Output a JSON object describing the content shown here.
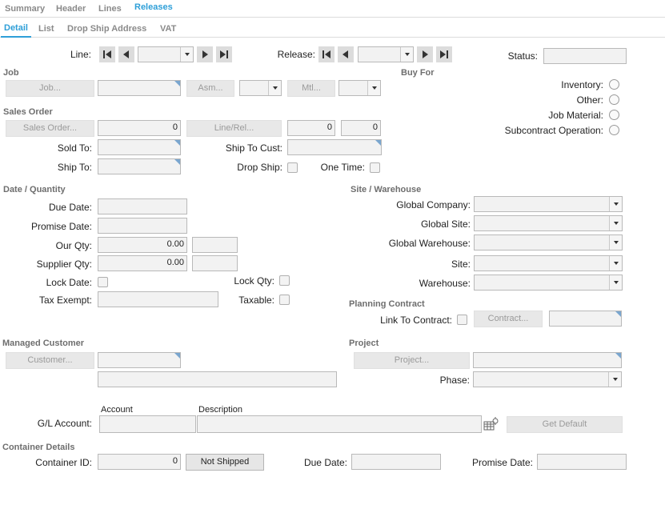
{
  "tabs_top": [
    "Summary",
    "Header",
    "Lines",
    "Releases"
  ],
  "tabs_sub": [
    "Detail",
    "List",
    "Drop Ship Address",
    "VAT"
  ],
  "line_label": "Line:",
  "release_label": "Release:",
  "status_label": "Status:",
  "job": {
    "section": "Job",
    "job_btn": "Job...",
    "asm_btn": "Asm...",
    "mtl_btn": "Mtl..."
  },
  "buy_for": {
    "section": "Buy For",
    "inventory": "Inventory:",
    "other": "Other:",
    "job_material": "Job Material:",
    "subcontract": "Subcontract Operation:"
  },
  "sales_order": {
    "section": "Sales Order",
    "so_btn": "Sales Order...",
    "so_value": "0",
    "linerel_btn": "Line/Rel...",
    "line_value": "0",
    "rel_value": "0",
    "sold_to": "Sold To:",
    "ship_to_cust": "Ship To Cust:",
    "ship_to": "Ship To:",
    "drop_ship": "Drop Ship:",
    "one_time": "One Time:"
  },
  "date_qty": {
    "section": "Date / Quantity",
    "due_date": "Due Date:",
    "promise_date": "Promise Date:",
    "our_qty": "Our Qty:",
    "our_qty_value": "0.00",
    "supplier_qty": "Supplier Qty:",
    "supplier_qty_value": "0.00",
    "lock_date": "Lock Date:",
    "lock_qty": "Lock Qty:",
    "tax_exempt": "Tax Exempt:",
    "taxable": "Taxable:"
  },
  "site_wh": {
    "section": "Site / Warehouse",
    "global_company": "Global Company:",
    "global_site": "Global Site:",
    "global_warehouse": "Global Warehouse:",
    "site": "Site:",
    "warehouse": "Warehouse:"
  },
  "planning": {
    "section": "Planning Contract",
    "link_label": "Link To Contract:",
    "contract_btn": "Contract..."
  },
  "managed_customer": {
    "section": "Managed Customer",
    "customer_btn": "Customer..."
  },
  "project": {
    "section": "Project",
    "project_btn": "Project...",
    "phase": "Phase:"
  },
  "gl": {
    "account_header": "Account",
    "description_header": "Description",
    "label": "G/L Account:",
    "get_default": "Get Default"
  },
  "container": {
    "section": "Container Details",
    "id_label": "Container ID:",
    "id_value": "0",
    "not_shipped": "Not Shipped",
    "due_date": "Due Date:",
    "promise_date": "Promise Date:"
  },
  "colors": {
    "accent": "#2e9fd8",
    "corner": "#7aa6cf"
  }
}
